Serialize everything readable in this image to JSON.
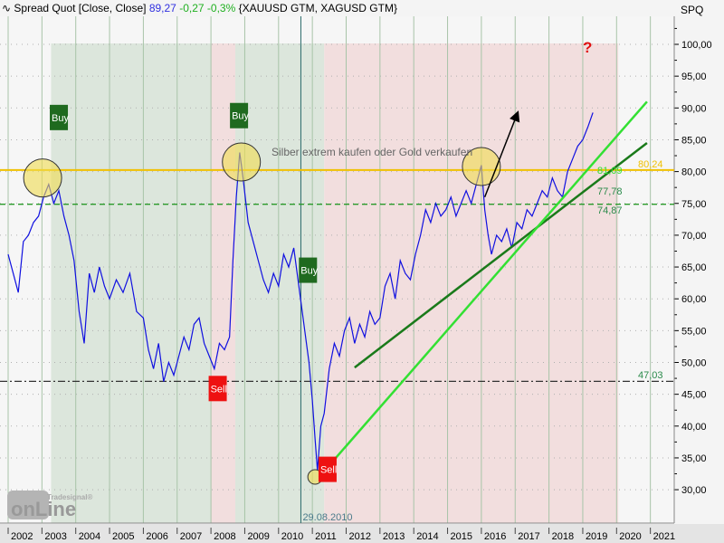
{
  "header": {
    "icon": "line-chart-icon",
    "title": "Spread Quot [Close, Close]",
    "last": "89,27",
    "change": "-0,27",
    "change_pct": "-0,3%",
    "symbols": "{XAUUSD GTM, XAGUSD GTM}",
    "axis_name": "SPQ"
  },
  "watermark": {
    "brand": "Tradesignal®",
    "word": "onLine"
  },
  "chart_data": {
    "type": "line",
    "title": "Spread Quot [Close, Close]",
    "ylim": [
      26,
      103
    ],
    "xlim": [
      2002,
      2021.6
    ],
    "yticks": [
      30,
      35,
      40,
      45,
      50,
      55,
      60,
      65,
      70,
      75,
      80,
      85,
      90,
      95,
      100
    ],
    "ytick_labels": [
      "30,00",
      "35,00",
      "40,00",
      "45,00",
      "50,00",
      "55,00",
      "60,00",
      "65,00",
      "70,00",
      "75,00",
      "80,00",
      "85,00",
      "90,00",
      "95,00",
      "100,00"
    ],
    "xticks": [
      "2002",
      "2003",
      "2004",
      "2005",
      "2006",
      "2007",
      "2008",
      "2009",
      "2010",
      "2011",
      "2012",
      "2013",
      "2014",
      "2015",
      "2016",
      "2017",
      "2018",
      "2019",
      "2020",
      "2021"
    ],
    "series": [
      {
        "name": "Spread Quot",
        "color": "#1010e0",
        "x": [
          2002.0,
          2002.15,
          2002.3,
          2002.45,
          2002.6,
          2002.75,
          2002.9,
          2003.05,
          2003.2,
          2003.35,
          2003.5,
          2003.65,
          2003.8,
          2003.95,
          2004.1,
          2004.25,
          2004.4,
          2004.55,
          2004.7,
          2004.85,
          2005.0,
          2005.2,
          2005.4,
          2005.6,
          2005.8,
          2006.0,
          2006.15,
          2006.3,
          2006.45,
          2006.6,
          2006.75,
          2006.9,
          2007.05,
          2007.2,
          2007.35,
          2007.5,
          2007.65,
          2007.8,
          2007.95,
          2008.1,
          2008.25,
          2008.4,
          2008.55,
          2008.65,
          2008.75,
          2008.85,
          2008.95,
          2009.1,
          2009.25,
          2009.4,
          2009.55,
          2009.7,
          2009.85,
          2010.0,
          2010.15,
          2010.3,
          2010.45,
          2010.6,
          2010.75,
          2010.9,
          2011.0,
          2011.08,
          2011.15,
          2011.25,
          2011.35,
          2011.5,
          2011.65,
          2011.8,
          2011.95,
          2012.1,
          2012.25,
          2012.4,
          2012.55,
          2012.7,
          2012.85,
          2013.0,
          2013.15,
          2013.3,
          2013.45,
          2013.6,
          2013.75,
          2013.9,
          2014.05,
          2014.2,
          2014.35,
          2014.5,
          2014.65,
          2014.8,
          2014.95,
          2015.1,
          2015.25,
          2015.4,
          2015.55,
          2015.7,
          2015.85,
          2016.0,
          2016.1,
          2016.2,
          2016.3,
          2016.45,
          2016.6,
          2016.75,
          2016.9,
          2017.05,
          2017.2,
          2017.35,
          2017.5,
          2017.65,
          2017.8,
          2017.95,
          2018.1,
          2018.25,
          2018.4,
          2018.55,
          2018.7,
          2018.85,
          2019.0,
          2019.15,
          2019.3
        ],
        "values": [
          67,
          64,
          61,
          69,
          70,
          72,
          73,
          76,
          78,
          75,
          77,
          73,
          70,
          66,
          58,
          53,
          64,
          61,
          65,
          62,
          60,
          63,
          61,
          64,
          58,
          57,
          52,
          49,
          53,
          47,
          50,
          48,
          51,
          54,
          52,
          56,
          57,
          53,
          51,
          49,
          53,
          52,
          54,
          66,
          76,
          83,
          79,
          72,
          69,
          66,
          63,
          61,
          64,
          62,
          67,
          65,
          68,
          62,
          56,
          50,
          44,
          38,
          33,
          40,
          42,
          49,
          53,
          51,
          55,
          57,
          53,
          56,
          54,
          58,
          56,
          57,
          62,
          64,
          60,
          66,
          64,
          63,
          67,
          70,
          74,
          72,
          75,
          73,
          74,
          76,
          73,
          75,
          77,
          75,
          78,
          81,
          74,
          70,
          67,
          70,
          69,
          71,
          68,
          72,
          71,
          74,
          73,
          75,
          77,
          76,
          79,
          77,
          76,
          80,
          82,
          84,
          85,
          87,
          89.27
        ]
      }
    ],
    "hlines": [
      {
        "value": 80.24,
        "label": "80,24",
        "color": "#f0c000",
        "style": "solid"
      },
      {
        "value": 74.87,
        "label": "74,87",
        "color": "#2a9a2a",
        "style": "dashed"
      },
      {
        "value": 47.03,
        "label": "47,03",
        "color": "#333333",
        "style": "dashdot"
      }
    ],
    "trendlines": [
      {
        "name": "support-dark",
        "from": [
          2012.25,
          49.2
        ],
        "to": [
          2020.9,
          84.5
        ],
        "color": "#1a7a1a",
        "label": "77,78"
      },
      {
        "name": "support-light",
        "from": [
          2011.2,
          32
        ],
        "to": [
          2020.9,
          91
        ],
        "color": "#33e033",
        "label": "81,09"
      }
    ],
    "regions": [
      {
        "from": 2003.27,
        "to": 2008.0,
        "kind": "buy",
        "color": "#dce6dc"
      },
      {
        "from": 2008.0,
        "to": 2008.72,
        "kind": "sell",
        "color": "#f2dede"
      },
      {
        "from": 2008.72,
        "to": 2011.35,
        "kind": "buy",
        "color": "#dce6dc"
      },
      {
        "from": 2011.35,
        "to": 2020.05,
        "kind": "sell",
        "color": "#f2dede"
      }
    ],
    "signals": [
      {
        "label": "Buy",
        "x": 2003.5,
        "y": 88.5,
        "color": "#1f6a1f"
      },
      {
        "label": "Buy",
        "x": 2008.83,
        "y": 88.8,
        "color": "#1f6a1f"
      },
      {
        "label": "Buy",
        "x": 2010.87,
        "y": 64.5,
        "color": "#1f6a1f"
      },
      {
        "label": "Sell",
        "x": 2008.2,
        "y": 45.9,
        "color": "#ee1111"
      },
      {
        "label": "Sell",
        "x": 2011.45,
        "y": 33.2,
        "color": "#ee1111"
      }
    ],
    "circles": [
      {
        "x": 2003.02,
        "y": 79
      },
      {
        "x": 2008.9,
        "y": 81.5
      },
      {
        "x": 2016.0,
        "y": 80.8
      },
      {
        "x": 2011.08,
        "y": 32
      }
    ],
    "arrow": {
      "from": [
        2016.1,
        76
      ],
      "to": [
        2017.07,
        89.2
      ]
    },
    "annotations": {
      "note": "Silber extrem kaufen oder Gold verkaufen",
      "question": "?",
      "date_marker": "29.08.2010",
      "date_marker_x": 2010.66
    }
  }
}
